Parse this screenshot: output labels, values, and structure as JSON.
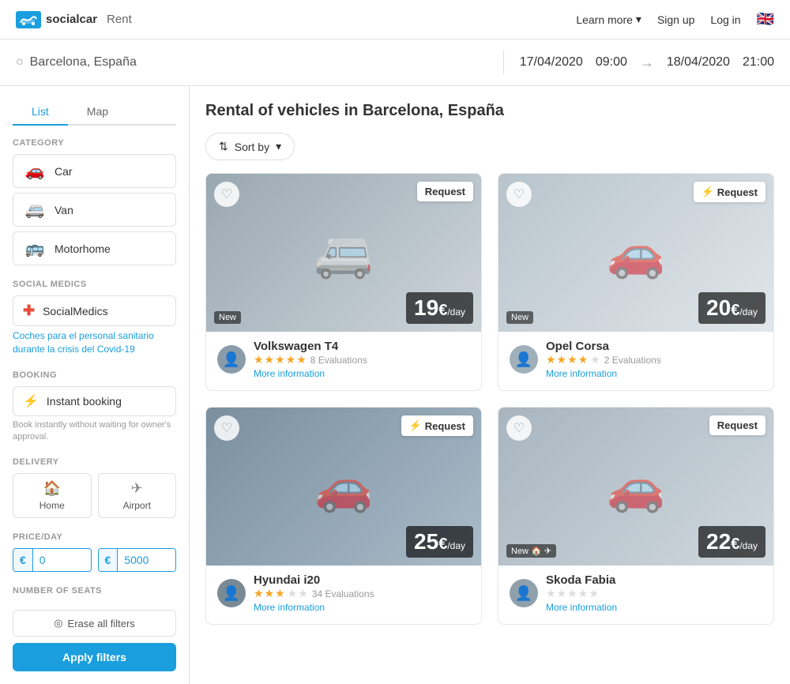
{
  "header": {
    "logo_text": "socialcar",
    "rent_label": "Rent",
    "learn_more": "Learn more",
    "signup": "Sign up",
    "login": "Log in"
  },
  "search": {
    "location": "Barcelona, España",
    "date_start": "17/04/2020",
    "time_start": "09:00",
    "date_end": "18/04/2020",
    "time_end": "21:00"
  },
  "tabs": {
    "list": "List",
    "map": "Map"
  },
  "page": {
    "title": "Rental of vehicles in Barcelona, España"
  },
  "sort": {
    "label": "Sort by"
  },
  "filters": {
    "category_label": "CATEGORY",
    "categories": [
      {
        "icon": "🚗",
        "label": "Car"
      },
      {
        "icon": "🚐",
        "label": "Van"
      },
      {
        "icon": "🚌",
        "label": "Motorhome"
      }
    ],
    "social_medics_label": "SOCIAL MEDICS",
    "social_medics_btn": "SocialMedics",
    "social_medics_note": "Coches para el personal sanitario durante la crisis del Covid-19",
    "booking_label": "BOOKING",
    "instant_booking": "Instant booking",
    "booking_note": "Book instantly without waiting for owner's approval.",
    "delivery_label": "DELIVERY",
    "delivery_home": "Home",
    "delivery_airport": "Airport",
    "price_label": "PRICE/DAY",
    "price_min": "0",
    "price_max": "5000",
    "price_currency": "€",
    "seats_label": "NUMBER OF SEATS",
    "erase_label": "Erase all filters",
    "apply_label": "Apply filters"
  },
  "cars": [
    {
      "id": 1,
      "name": "Volkswagen T4",
      "badge": "Request",
      "instant": false,
      "new_badge": "New",
      "price": "19",
      "currency": "€",
      "per_day": "/day",
      "stars": 5,
      "evaluations": "8 Evaluations",
      "more_info": "More information",
      "avatar_emoji": "👤",
      "bg_color": "#b0b8c0",
      "car_emoji": "🚐"
    },
    {
      "id": 2,
      "name": "Opel Corsa",
      "badge": "Request",
      "instant": true,
      "new_badge": "New",
      "price": "20",
      "currency": "€",
      "per_day": "/day",
      "stars": 4,
      "evaluations": "2 Evaluations",
      "more_info": "More information",
      "avatar_emoji": "👤",
      "bg_color": "#c8cfd4",
      "car_emoji": "🚗"
    },
    {
      "id": 3,
      "name": "Hyundai i20",
      "badge": "Request",
      "instant": true,
      "new_badge": "",
      "price": "25",
      "currency": "€",
      "per_day": "/day",
      "stars": 3,
      "evaluations": "34 Evaluations",
      "more_info": "More information",
      "avatar_emoji": "👤",
      "bg_color": "#8a9baa",
      "car_emoji": "🚗"
    },
    {
      "id": 4,
      "name": "Skoda Fabia",
      "badge": "Request",
      "instant": false,
      "new_badge": "New",
      "price": "22",
      "currency": "€",
      "per_day": "/day",
      "stars": 0,
      "evaluations": "",
      "more_info": "More information",
      "avatar_emoji": "👤",
      "bg_color": "#b5bfc8",
      "car_emoji": "🚗"
    }
  ]
}
